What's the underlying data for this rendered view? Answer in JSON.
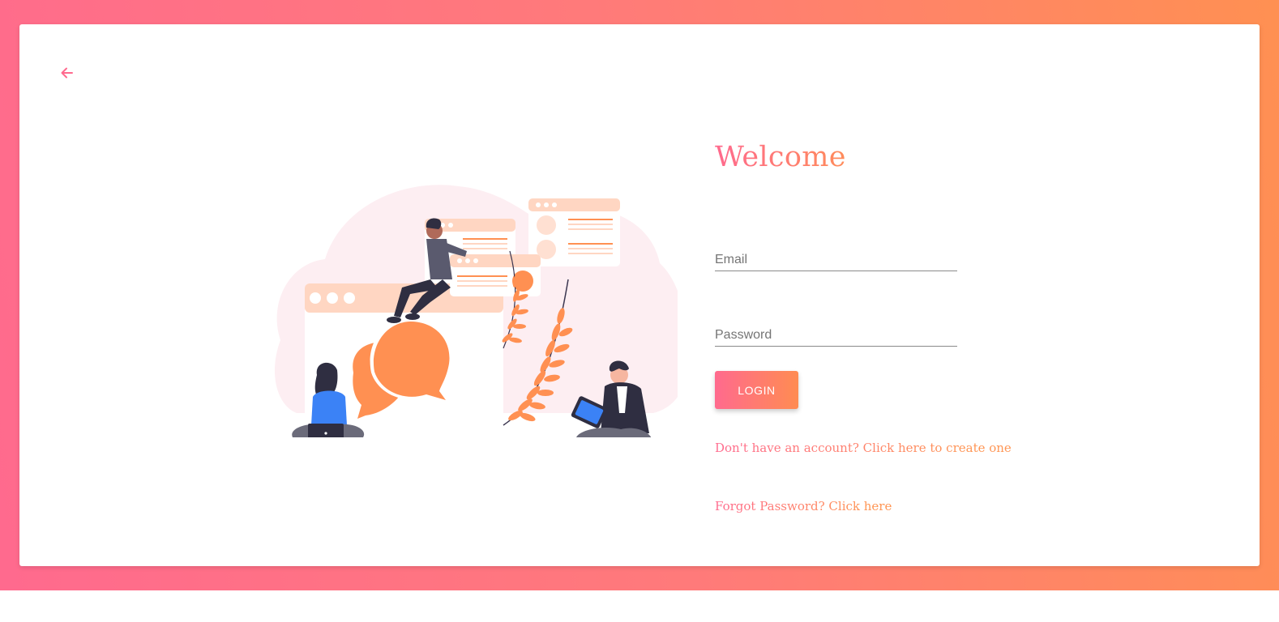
{
  "page": {
    "title": "Welcome",
    "back_icon": "arrow-left-icon",
    "accent_start": "#ff6a8e",
    "accent_end": "#ff9052",
    "illustration": "people-chatting-illustration"
  },
  "form": {
    "email_placeholder": "Email",
    "email_value": "",
    "password_placeholder": "Password",
    "password_value": "",
    "login_label": "LOGIN"
  },
  "links": {
    "signup": "Don't have an account? Click here to create one",
    "forgot": "Forgot Password? Click here"
  }
}
